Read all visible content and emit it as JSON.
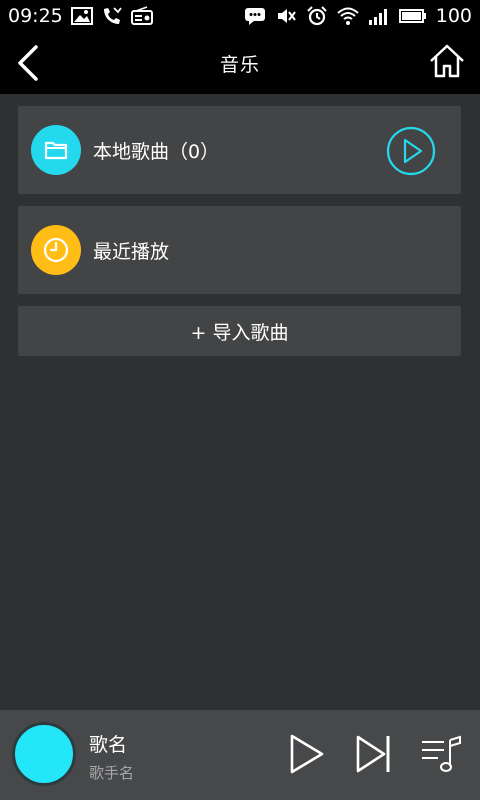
{
  "status_bar": {
    "time": "09:25",
    "battery_level": "100"
  },
  "header": {
    "title": "音乐",
    "back_icon": "chevron-left-icon",
    "home_icon": "home-icon"
  },
  "list": {
    "local": {
      "label": "本地歌曲（0）",
      "icon": "folder-icon",
      "icon_color": "#24d9ee"
    },
    "recent": {
      "label": "最近播放",
      "icon": "clock-icon",
      "icon_color": "#ffbd16"
    },
    "import": {
      "label": "+ 导入歌曲"
    }
  },
  "player": {
    "song": "歌名",
    "artist": "歌手名",
    "art_color": "#24e6f9"
  },
  "colors": {
    "accent": "#24d9ee",
    "card": "#434445",
    "background": "#2f3031"
  }
}
